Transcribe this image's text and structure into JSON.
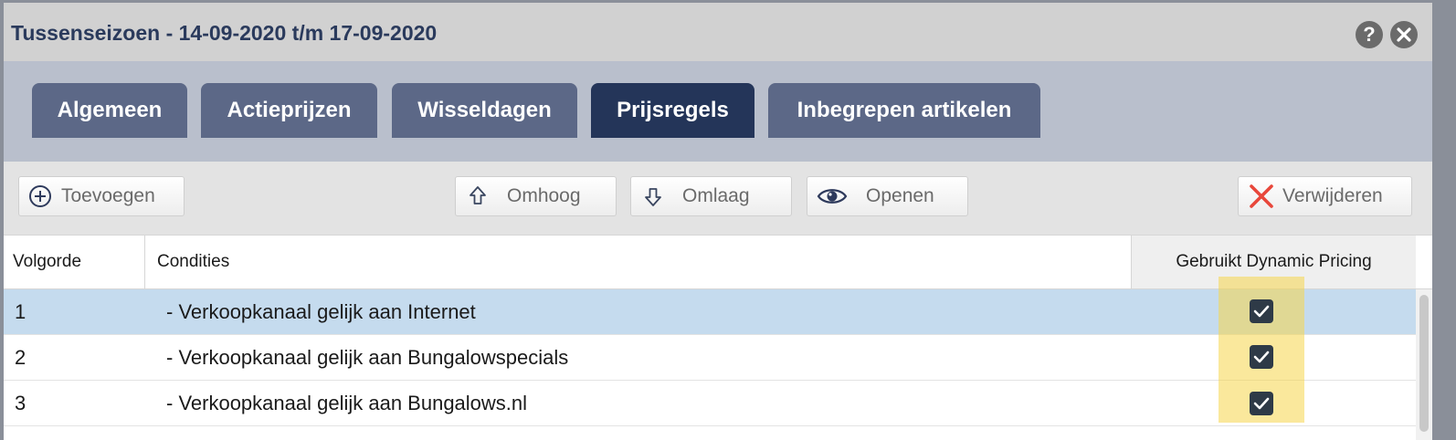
{
  "window": {
    "title": "Tussenseizoen - 14-09-2020 t/m 17-09-2020",
    "help_icon": "help-icon",
    "close_icon": "close-icon"
  },
  "tabs": [
    {
      "label": "Algemeen",
      "active": false
    },
    {
      "label": "Actieprijzen",
      "active": false
    },
    {
      "label": "Wisseldagen",
      "active": false
    },
    {
      "label": "Prijsregels",
      "active": true
    },
    {
      "label": "Inbegrepen artikelen",
      "active": false
    }
  ],
  "toolbar": {
    "add_label": "Toevoegen",
    "up_label": "Omhoog",
    "down_label": "Omlaag",
    "open_label": "Openen",
    "delete_label": "Verwijderen"
  },
  "table": {
    "columns": [
      "Volgorde",
      "Condities",
      "Gebruikt Dynamic Pricing"
    ],
    "rows": [
      {
        "order": "1",
        "condition": "- Verkoopkanaal gelijk aan Internet",
        "dynamic_pricing": true,
        "selected": true
      },
      {
        "order": "2",
        "condition": "- Verkoopkanaal gelijk aan Bungalowspecials",
        "dynamic_pricing": true,
        "selected": false
      },
      {
        "order": "3",
        "condition": "- Verkoopkanaal gelijk aan Bungalows.nl",
        "dynamic_pricing": true,
        "selected": false
      }
    ]
  },
  "colors": {
    "tab_inactive": "#5c6887",
    "tab_active": "#243559",
    "title_text": "#2a3a5c",
    "row_selected": "#c5dbee",
    "highlight": "#f6d64a",
    "delete_icon": "#e8473b"
  }
}
